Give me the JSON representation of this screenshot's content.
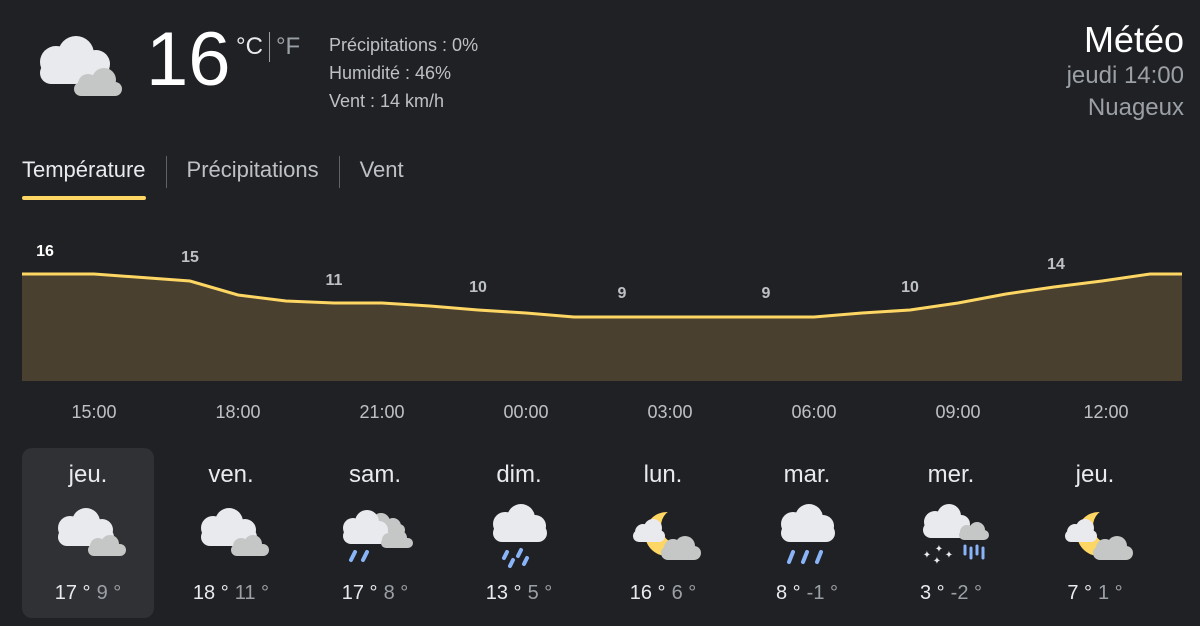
{
  "current": {
    "icon": "cloudy-icon",
    "temperature": "16",
    "unit_c": "°C",
    "unit_f": "°F",
    "precipitation": "Précipitations : 0%",
    "humidity": "Humidité : 46%",
    "wind": "Vent : 14 km/h"
  },
  "header": {
    "title": "Météo",
    "datetime": "jeudi 14:00",
    "condition": "Nuageux"
  },
  "tabs": [
    {
      "label": "Température",
      "active": true
    },
    {
      "label": "Précipitations",
      "active": false
    },
    {
      "label": "Vent",
      "active": false
    }
  ],
  "accent_color": "#fdd663",
  "hourly": {
    "temp_labels": [
      "16",
      "15",
      "11",
      "10",
      "9",
      "9",
      "10",
      "14"
    ],
    "times": [
      "15:00",
      "18:00",
      "21:00",
      "00:00",
      "03:00",
      "06:00",
      "09:00",
      "12:00"
    ]
  },
  "days": [
    {
      "name": "jeu.",
      "icon": "cloudy-icon",
      "hi": "17 °",
      "lo": "9 °",
      "selected": true
    },
    {
      "name": "ven.",
      "icon": "cloudy-icon",
      "hi": "18 °",
      "lo": "11 °",
      "selected": false
    },
    {
      "name": "sam.",
      "icon": "rain-showers-icon",
      "hi": "17 °",
      "lo": "8 °",
      "selected": false
    },
    {
      "name": "dim.",
      "icon": "rain-icon",
      "hi": "13 °",
      "lo": "5 °",
      "selected": false
    },
    {
      "name": "lun.",
      "icon": "partly-cloudy-night-icon",
      "hi": "16 °",
      "lo": "6 °",
      "selected": false
    },
    {
      "name": "mar.",
      "icon": "rain-icon",
      "hi": "8 °",
      "lo": "-1 °",
      "selected": false
    },
    {
      "name": "mer.",
      "icon": "snow-rain-icon",
      "hi": "3 °",
      "lo": "-2 °",
      "selected": false
    },
    {
      "name": "jeu.",
      "icon": "partly-cloudy-night-icon",
      "hi": "7 °",
      "lo": "1 °",
      "selected": false
    }
  ]
}
